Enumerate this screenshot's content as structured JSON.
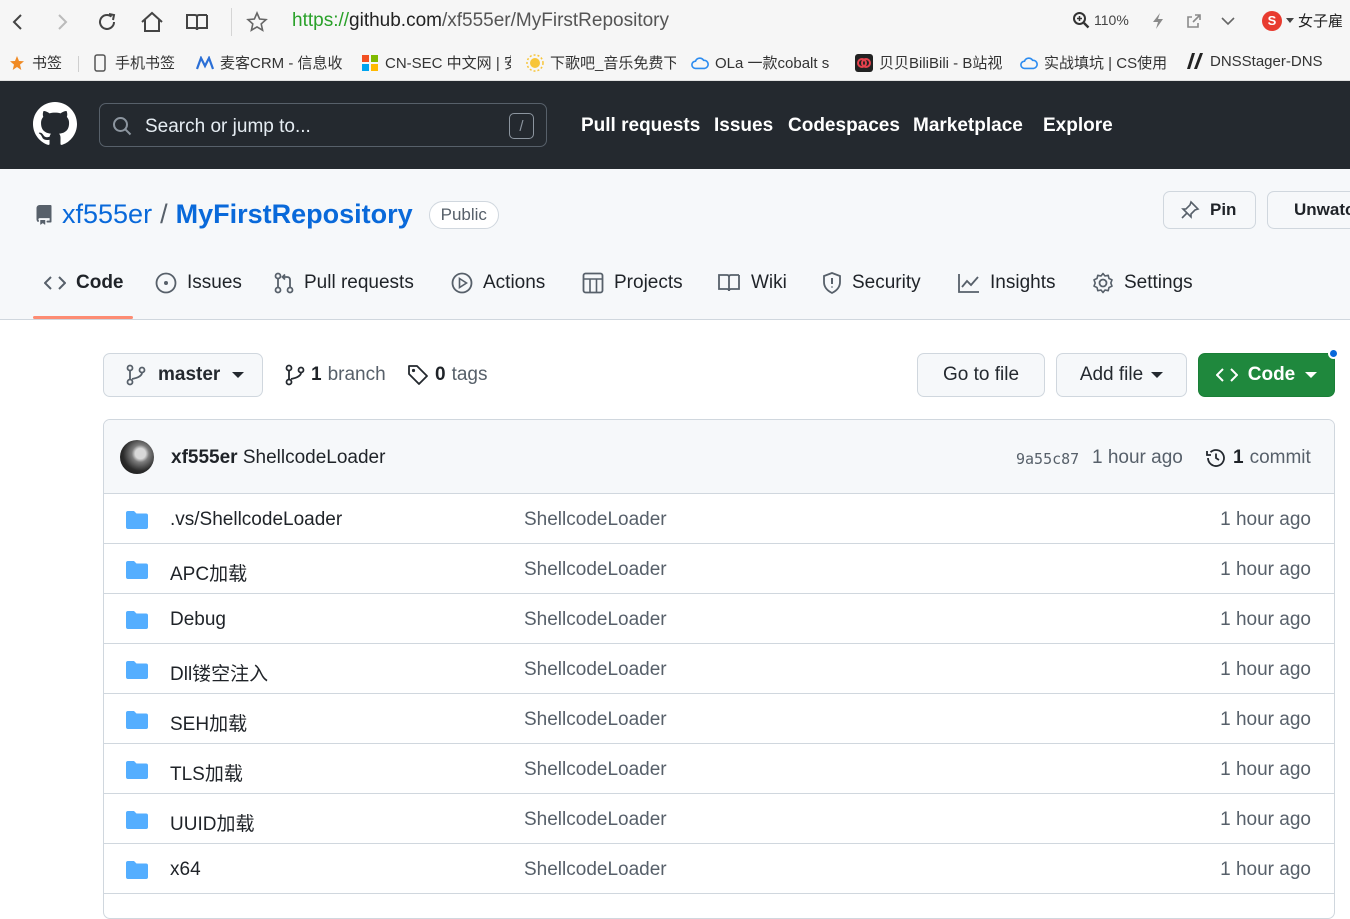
{
  "browser": {
    "url_scheme": "https://",
    "url_host": "github.com",
    "url_path": "/xf555er/MyFirstRepository",
    "zoom": "110%",
    "profile_label": "女子雇"
  },
  "bookmarks": [
    {
      "label": "书签"
    },
    {
      "label": "手机书签"
    },
    {
      "label": "麦客CRM - 信息收"
    },
    {
      "label": "CN-SEC 中文网 | 安"
    },
    {
      "label": "下歌吧_音乐免费下"
    },
    {
      "label": "OLa 一款cobalt s"
    },
    {
      "label": "贝贝BiliBili - B站视"
    },
    {
      "label": "实战填坑 | CS使用"
    },
    {
      "label": "DNSStager-DNS"
    }
  ],
  "github": {
    "search_placeholder": "Search or jump to...",
    "search_shortcut": "/",
    "nav": [
      "Pull requests",
      "Issues",
      "Codespaces",
      "Marketplace",
      "Explore"
    ]
  },
  "repo": {
    "owner": "xf555er",
    "separator": "/",
    "name": "MyFirstRepository",
    "visibility": "Public",
    "pin_label": "Pin",
    "watch_label": "Unwatch"
  },
  "tabs": [
    {
      "label": "Code",
      "icon": "code-icon",
      "active": true
    },
    {
      "label": "Issues",
      "icon": "issue-icon"
    },
    {
      "label": "Pull requests",
      "icon": "pull-request-icon"
    },
    {
      "label": "Actions",
      "icon": "play-icon"
    },
    {
      "label": "Projects",
      "icon": "table-icon"
    },
    {
      "label": "Wiki",
      "icon": "book-icon"
    },
    {
      "label": "Security",
      "icon": "shield-icon"
    },
    {
      "label": "Insights",
      "icon": "graph-icon"
    },
    {
      "label": "Settings",
      "icon": "gear-icon"
    }
  ],
  "toolbar": {
    "branch_name": "master",
    "branch_count": "1",
    "branch_label": "branch",
    "tag_count": "0",
    "tag_label": "tags",
    "goto_file": "Go to file",
    "add_file": "Add file",
    "code_button": "Code"
  },
  "commit": {
    "author": "xf555er",
    "message": "ShellcodeLoader",
    "sha": "9a55c87",
    "time": "1 hour ago",
    "count": "1",
    "count_label": "commit"
  },
  "files": [
    {
      "name": ".vs/ShellcodeLoader",
      "message": "ShellcodeLoader",
      "time": "1 hour ago"
    },
    {
      "name": "APC加载",
      "message": "ShellcodeLoader",
      "time": "1 hour ago"
    },
    {
      "name": "Debug",
      "message": "ShellcodeLoader",
      "time": "1 hour ago"
    },
    {
      "name": "Dll镂空注入",
      "message": "ShellcodeLoader",
      "time": "1 hour ago"
    },
    {
      "name": "SEH加载",
      "message": "ShellcodeLoader",
      "time": "1 hour ago"
    },
    {
      "name": "TLS加载",
      "message": "ShellcodeLoader",
      "time": "1 hour ago"
    },
    {
      "name": "UUID加载",
      "message": "ShellcodeLoader",
      "time": "1 hour ago"
    },
    {
      "name": "x64",
      "message": "ShellcodeLoader",
      "time": "1 hour ago"
    }
  ],
  "colors": {
    "header_bg": "#24292f",
    "link_blue": "#0969da",
    "primary_green": "#1f883d",
    "folder_blue": "#54aeff",
    "tab_accent": "#fd8c73"
  }
}
